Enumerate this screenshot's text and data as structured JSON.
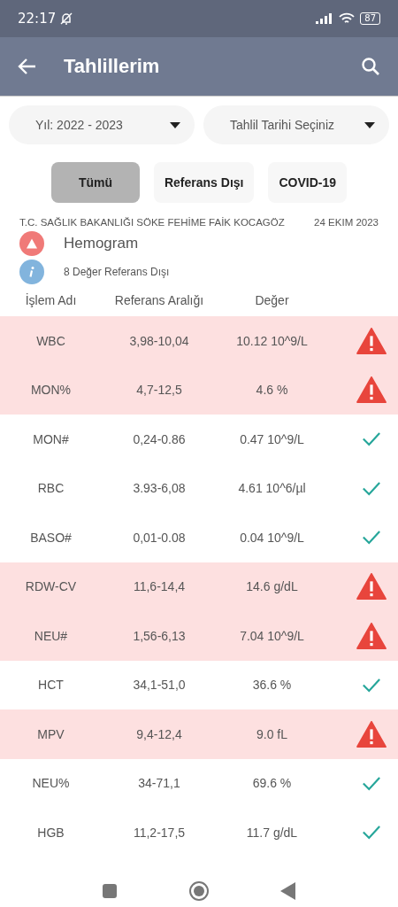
{
  "status_bar": {
    "time": "22:17",
    "battery": "87"
  },
  "app_bar": {
    "title": "Tahlillerim"
  },
  "dropdowns": [
    {
      "value": "Yıl: 2022 - 2023"
    },
    {
      "value": "Tahlil Tarihi Seçiniz"
    }
  ],
  "filters": [
    {
      "label": "Tümü",
      "selected": true
    },
    {
      "label": "Referans Dışı",
      "selected": false
    },
    {
      "label": "COVID-19",
      "selected": false
    }
  ],
  "report": {
    "institution": "T.C. SAĞLIK BAKANLIĞI SÖKE FEHİME FAİK KOCAGÖZ",
    "date": "24 EKIM 2023",
    "title": "Hemogram",
    "summary": "8 Değer Referans Dışı"
  },
  "table": {
    "columns": [
      "İşlem Adı",
      "Referans Aralığı",
      "Değer"
    ],
    "rows": [
      {
        "name": "WBC",
        "range": "3,98-10,04",
        "value": "10.12 10^9/L",
        "out_of_range": true
      },
      {
        "name": "MON%",
        "range": "4,7-12,5",
        "value": "4.6 %",
        "out_of_range": true
      },
      {
        "name": "MON#",
        "range": "0,24-0.86",
        "value": "0.47 10^9/L",
        "out_of_range": false
      },
      {
        "name": "RBC",
        "range": "3.93-6,08",
        "value": "4.61 10^6/µl",
        "out_of_range": false
      },
      {
        "name": "BASO#",
        "range": "0,01-0.08",
        "value": "0.04 10^9/L",
        "out_of_range": false
      },
      {
        "name": "RDW-CV",
        "range": "11,6-14,4",
        "value": "14.6 g/dL",
        "out_of_range": true
      },
      {
        "name": "NEU#",
        "range": "1,56-6,13",
        "value": "7.04 10^9/L",
        "out_of_range": true
      },
      {
        "name": "HCT",
        "range": "34,1-51,0",
        "value": "36.6 %",
        "out_of_range": false
      },
      {
        "name": "MPV",
        "range": "9,4-12,4",
        "value": "9.0 fL",
        "out_of_range": true
      },
      {
        "name": "NEU%",
        "range": "34-71,1",
        "value": "69.6 %",
        "out_of_range": false
      },
      {
        "name": "HGB",
        "range": "11,2-17,5",
        "value": "11.7 g/dL",
        "out_of_range": false
      }
    ]
  }
}
